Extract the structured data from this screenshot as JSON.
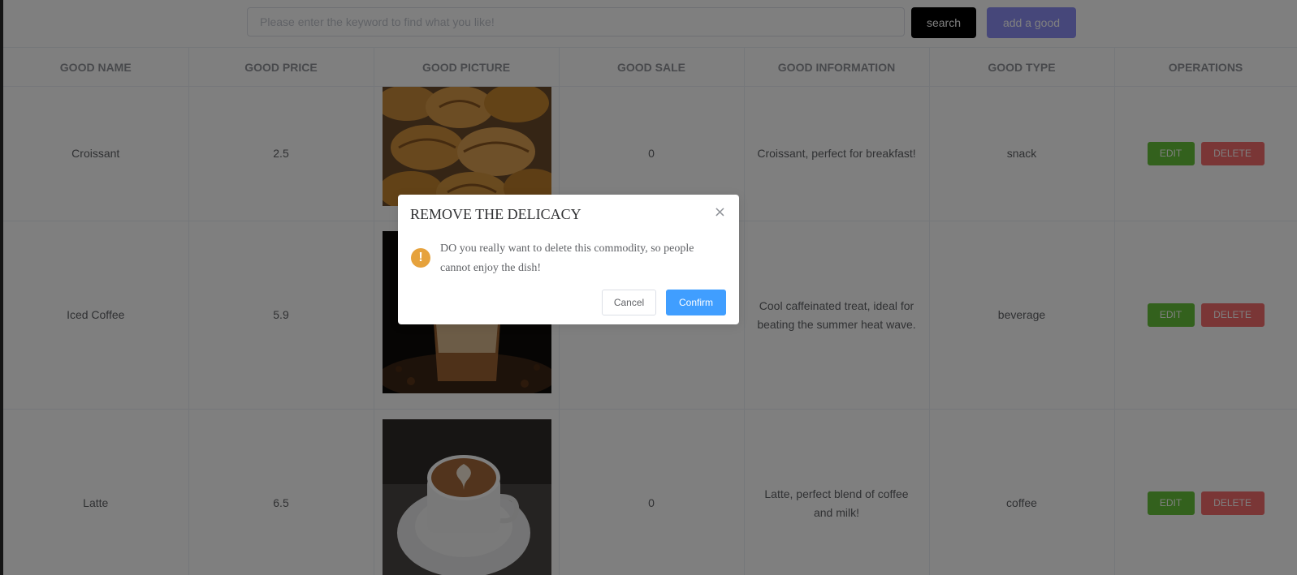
{
  "toolbar": {
    "search_placeholder": "Please enter the keyword to find what you like!",
    "search_value": "",
    "search_label": "search",
    "add_label": "add a good"
  },
  "table": {
    "headers": [
      "GOOD NAME",
      "GOOD PRICE",
      "GOOD PICTURE",
      "GOOD SALE",
      "GOOD INFORMATION",
      "GOOD TYPE",
      "OPERATIONS"
    ],
    "rows": [
      {
        "name": "Croissant",
        "price": "2.5",
        "picture": "croissant-photo",
        "sale": "0",
        "information": "Croissant, perfect for breakfast!",
        "type": "snack"
      },
      {
        "name": "Iced Coffee",
        "price": "5.9",
        "picture": "iced-coffee-photo",
        "sale": "",
        "information": "Cool caffeinated treat, ideal for beating the summer heat wave.",
        "type": "beverage"
      },
      {
        "name": "Latte",
        "price": "6.5",
        "picture": "latte-photo",
        "sale": "0",
        "information": "Latte, perfect blend of coffee and milk!",
        "type": "coffee"
      }
    ],
    "edit_label": "EDIT",
    "delete_label": "DELETE"
  },
  "dialog": {
    "title": "REMOVE THE DELICACY",
    "close_icon": "×",
    "warning_icon": "!",
    "message": "DO you really want to delete this commodity, so people cannot enjoy the dish!",
    "cancel_label": "Cancel",
    "confirm_label": "Confirm"
  },
  "colors": {
    "search_button": "#000000",
    "add_button": "#8d8ef5",
    "edit_button": "#67c23a",
    "delete_button": "#f56c6c",
    "confirm_button": "#409eff",
    "warning": "#e6a23c",
    "overlay": "rgba(0,0,0,0.5)"
  }
}
